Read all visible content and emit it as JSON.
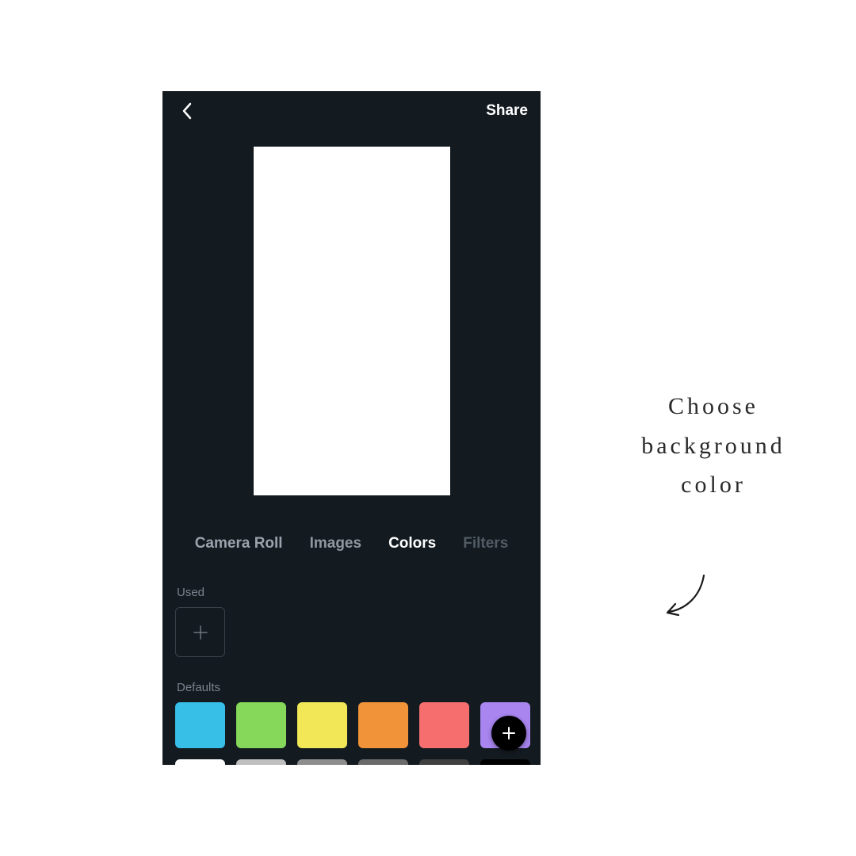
{
  "topbar": {
    "share_label": "Share"
  },
  "tabs": {
    "camera_roll": "Camera Roll",
    "images": "Images",
    "colors": "Colors",
    "filters": "Filters",
    "active": "colors"
  },
  "sections": {
    "used_label": "Used",
    "defaults_label": "Defaults"
  },
  "canvas": {
    "background": "#ffffff"
  },
  "defaults_row1": [
    {
      "name": "sky-blue",
      "hex": "#37bfe8"
    },
    {
      "name": "lime-green",
      "hex": "#86d85a"
    },
    {
      "name": "yellow",
      "hex": "#f2e757"
    },
    {
      "name": "orange",
      "hex": "#f09339"
    },
    {
      "name": "coral",
      "hex": "#f76e6e"
    },
    {
      "name": "purple",
      "hex": "#a885ef"
    }
  ],
  "defaults_row2": [
    {
      "name": "white",
      "hex": "#ffffff"
    },
    {
      "name": "light-gray",
      "hex": "#bfbfbf"
    },
    {
      "name": "gray",
      "hex": "#8e8e8e"
    },
    {
      "name": "dim-gray",
      "hex": "#6a6a6a"
    },
    {
      "name": "dark-gray",
      "hex": "#404040"
    },
    {
      "name": "black",
      "hex": "#000000"
    }
  ],
  "annotation": {
    "line1": "Choose",
    "line2": "background",
    "line3": "color"
  }
}
